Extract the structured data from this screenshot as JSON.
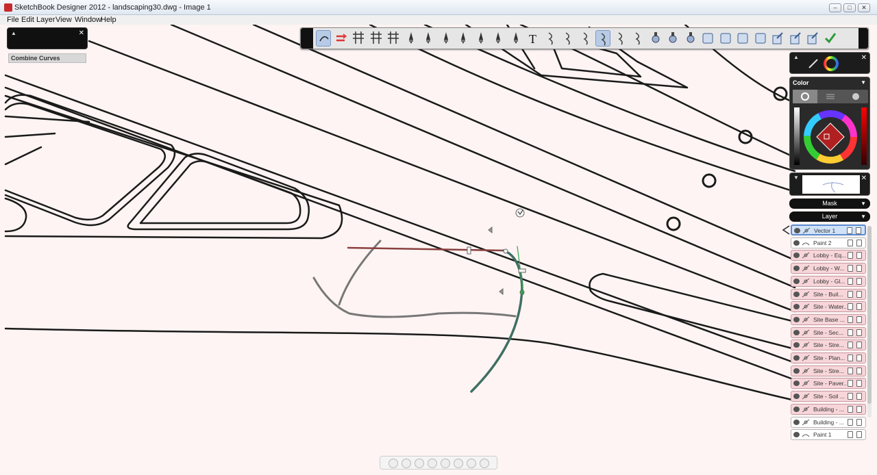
{
  "window": {
    "title": "SketchBook Designer 2012 - landscaping30.dwg - Image 1",
    "controls": [
      "–",
      "□",
      "✕"
    ]
  },
  "menu": [
    "File",
    "Edit",
    "Layer",
    "View",
    "Window",
    "Help"
  ],
  "left_panel": {
    "label": "Combine Curves"
  },
  "toolbar": {
    "tools": [
      {
        "icon": "combine-curves-icon",
        "active": true
      },
      {
        "icon": "reverse-curve-icon"
      },
      {
        "icon": "trim-icon"
      },
      {
        "icon": "trim-extend-icon"
      },
      {
        "icon": "intersect-icon"
      },
      {
        "icon": "pencil-icon"
      },
      {
        "icon": "ballpoint-pen-icon"
      },
      {
        "icon": "fine-pen-icon"
      },
      {
        "icon": "marker-icon"
      },
      {
        "icon": "chisel-marker-icon"
      },
      {
        "icon": "brush-icon"
      },
      {
        "icon": "airbrush-icon"
      },
      {
        "icon": "text-icon"
      },
      {
        "icon": "curve-1-icon"
      },
      {
        "icon": "curve-2-icon"
      },
      {
        "icon": "curve-3-icon"
      },
      {
        "icon": "curve-4-icon",
        "active": true
      },
      {
        "icon": "curve-5-icon"
      },
      {
        "icon": "curve-6-icon"
      },
      {
        "icon": "stamp-1-icon"
      },
      {
        "icon": "stamp-2-icon"
      },
      {
        "icon": "stamp-3-icon"
      },
      {
        "icon": "shape-1-icon"
      },
      {
        "icon": "shape-2-icon"
      },
      {
        "icon": "shape-3-icon"
      },
      {
        "icon": "shape-4-icon"
      },
      {
        "icon": "transform-1-icon"
      },
      {
        "icon": "transform-2-icon"
      },
      {
        "icon": "transform-3-icon"
      },
      {
        "icon": "accept-icon"
      }
    ]
  },
  "color_panel": {
    "header": "Color"
  },
  "dropdowns": {
    "mask": "Mask",
    "layer": "Layer"
  },
  "layers": [
    {
      "name": "Vector 1",
      "style": "selected",
      "icon": "vector"
    },
    {
      "name": "Paint 2",
      "style": "white",
      "icon": "paint"
    },
    {
      "name": "Lobby - Eq...",
      "style": "pink",
      "icon": "vector"
    },
    {
      "name": "Lobby - W...",
      "style": "pink",
      "icon": "vector"
    },
    {
      "name": "Lobby - Gl...",
      "style": "pink",
      "icon": "vector"
    },
    {
      "name": "Site - Buil...",
      "style": "pink",
      "icon": "vector"
    },
    {
      "name": "Site - Water...",
      "style": "pink",
      "icon": "vector"
    },
    {
      "name": "Site Base ...",
      "style": "pink",
      "icon": "vector"
    },
    {
      "name": "Site - Sec...",
      "style": "pink",
      "icon": "vector"
    },
    {
      "name": "Site - Stre...",
      "style": "pink",
      "icon": "vector"
    },
    {
      "name": "Site - Plan...",
      "style": "pink",
      "icon": "vector"
    },
    {
      "name": "Site - Stre...",
      "style": "pink",
      "icon": "vector"
    },
    {
      "name": "Site - Paver...",
      "style": "pink",
      "icon": "vector"
    },
    {
      "name": "Site - Soil ...",
      "style": "pink",
      "icon": "vector"
    },
    {
      "name": "Building - ...",
      "style": "pink",
      "icon": "vector"
    },
    {
      "name": "Building - ...",
      "style": "white",
      "icon": "vector"
    },
    {
      "name": "Paint 1",
      "style": "white",
      "icon": "paint"
    }
  ],
  "bottom_nav": [
    "lasso-icon",
    "home-icon",
    "zoom-in-icon",
    "zoom-out-icon",
    "pan-icon",
    "rotate-icon",
    "fit-icon",
    "flip-icon"
  ],
  "colors": {
    "accent": "#5b8ad0",
    "layer_pink": "#f7d5d9",
    "canvas": "#fdf4f3"
  }
}
